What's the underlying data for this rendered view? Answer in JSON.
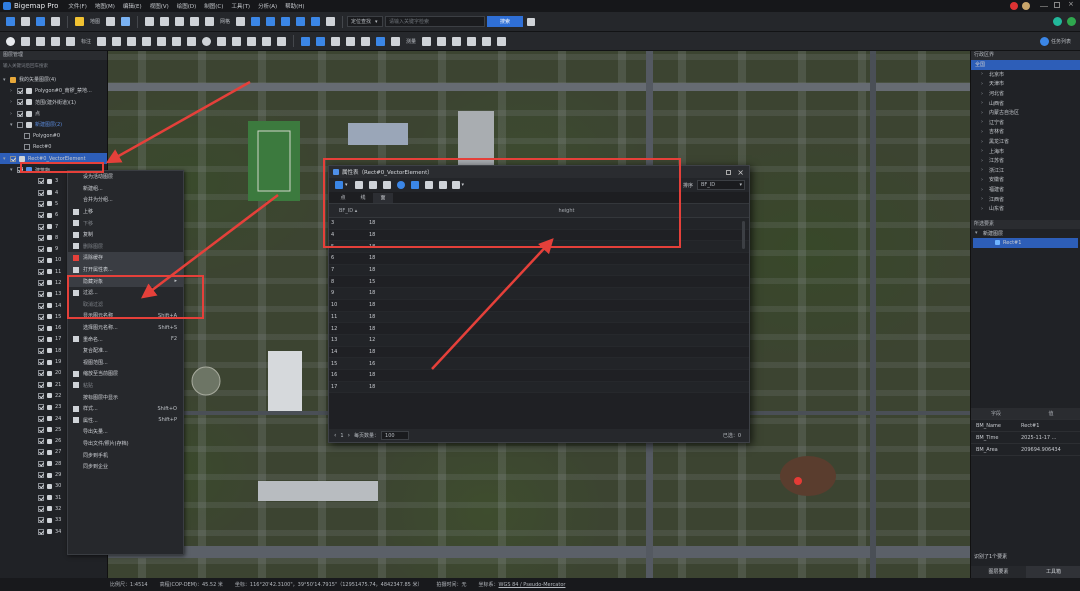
{
  "app": {
    "title": "Bigemap Pro"
  },
  "menu": [
    "文件(F)",
    "地图(M)",
    "编辑(E)",
    "视图(V)",
    "绘图(D)",
    "制图(C)",
    "工具(T)",
    "分析(A)",
    "帮助(H)"
  ],
  "toolbar1": {
    "labels": [
      "地图",
      "网格"
    ],
    "search_mode": "定位查找",
    "search_placeholder": "请输入关键字检索",
    "search_button": "搜索"
  },
  "toolbar2": {
    "labels": [
      "标注",
      "测量"
    ],
    "task_button": "任务列表"
  },
  "layers": {
    "header": "图层管理",
    "search_placeholder": "输入关键词后回车搜索",
    "items": [
      {
        "label": "我的矢量图层(4)"
      },
      {
        "label": "Polygon#0_南锣_禁地..."
      },
      {
        "label": "范围(建外街道)(1)"
      },
      {
        "label": "点"
      },
      {
        "label": "新建图层(2)"
      },
      {
        "label": "Polygon#0"
      },
      {
        "label": "Rect#0"
      },
      {
        "label": "Rect#0_VectorElement"
      },
      {
        "label": "建筑物"
      }
    ],
    "rows": [
      "3",
      "4",
      "5",
      "6",
      "7",
      "8",
      "9",
      "10",
      "11",
      "12",
      "13",
      "14",
      "15",
      "16",
      "17",
      "18",
      "19",
      "20",
      "21",
      "22",
      "23",
      "24",
      "25",
      "26",
      "27",
      "28",
      "29",
      "30",
      "31",
      "32",
      "33",
      "34"
    ]
  },
  "context_menu": [
    {
      "label": "设为活动图层",
      "shortcut": ""
    },
    {
      "label": "新建组...",
      "shortcut": ""
    },
    {
      "label": "合并为分组...",
      "shortcut": ""
    },
    {
      "label": "上移",
      "shortcut": ""
    },
    {
      "label": "下移",
      "shortcut": ""
    },
    {
      "label": "复制",
      "shortcut": ""
    },
    {
      "label": "删除图层",
      "shortcut": ""
    },
    {
      "label": "清除缓存",
      "shortcut": ""
    },
    {
      "label": "打开属性表...",
      "shortcut": ""
    },
    {
      "label": "隐藏对象",
      "shortcut": ""
    },
    {
      "label": "过滤...",
      "shortcut": ""
    },
    {
      "label": "取消过滤",
      "shortcut": ""
    },
    {
      "label": "显示图元名称",
      "shortcut": "Shift+A"
    },
    {
      "label": "选择图元名称...",
      "shortcut": "Shift+S"
    },
    {
      "label": "重命名...",
      "shortcut": "F2"
    },
    {
      "label": "复合配准...",
      "shortcut": ""
    },
    {
      "label": "视图范围...",
      "shortcut": ""
    },
    {
      "label": "缩放至当前图层",
      "shortcut": ""
    },
    {
      "label": "粘贴",
      "shortcut": ""
    },
    {
      "label": "按标图层中显示",
      "shortcut": ""
    },
    {
      "label": "样式...",
      "shortcut": "Shift+O"
    },
    {
      "label": "属性...",
      "shortcut": "Shift+P"
    },
    {
      "label": "导出矢量...",
      "shortcut": ""
    },
    {
      "label": "导出文件/照片(存档)",
      "shortcut": ""
    },
    {
      "label": "同步到手机",
      "shortcut": ""
    },
    {
      "label": "同步到企业",
      "shortcut": ""
    }
  ],
  "attr_window": {
    "title": "属性表（Rect#0_VectorElement）",
    "sort_label": "排序",
    "sort_field": "BF_ID",
    "tabs": [
      "点",
      "线",
      "面"
    ],
    "columns": [
      "BF_ID",
      "height"
    ],
    "rows": [
      [
        "3",
        "18"
      ],
      [
        "4",
        "18"
      ],
      [
        "5",
        "18"
      ],
      [
        "6",
        "18"
      ],
      [
        "7",
        "18"
      ],
      [
        "8",
        "15"
      ],
      [
        "9",
        "18"
      ],
      [
        "10",
        "18"
      ],
      [
        "11",
        "18"
      ],
      [
        "12",
        "18"
      ],
      [
        "13",
        "12"
      ],
      [
        "14",
        "18"
      ],
      [
        "15",
        "16"
      ],
      [
        "16",
        "18"
      ],
      [
        "17",
        "18"
      ]
    ],
    "footer": {
      "page": "1",
      "page_size_label": "每页数量：",
      "page_size": "100",
      "selected": "已选：0"
    }
  },
  "right_panel": {
    "header": "行政区界",
    "regions": [
      "全国",
      "北京市",
      "天津市",
      "河北省",
      "山西省",
      "内蒙古自治区",
      "辽宁省",
      "吉林省",
      "黑龙江省",
      "上海市",
      "江苏省",
      "浙江江",
      "安徽省",
      "福建省",
      "江西省",
      "山东省"
    ],
    "selected_header": "所选要素",
    "selected_group": "新建图层",
    "selected_item": "Rect#1",
    "props_header": [
      "字段",
      "值"
    ],
    "props": [
      [
        "BM_Name",
        "Rect#1"
      ],
      [
        "BM_Time",
        "2025-11-17 ..."
      ],
      [
        "BM_Area",
        "209694.906434"
      ]
    ],
    "status": "识别了1个要素",
    "tabs": [
      "图层要素",
      "工具箱"
    ]
  },
  "statusbar": {
    "scale_label": "比例尺：",
    "scale": "1:4514",
    "elev_label": "高程(COP-DEM)：",
    "elev": "45.52 米",
    "coord_label": "坐标：",
    "coord": "116°20'42.3100\"，39°50'14.7915\"（12951475.74，4842347.85 米）",
    "capture_label": "拍摄时间：",
    "capture": "无",
    "crs_label": "坐标系：",
    "crs": "WGS 84 / Pseudo-Mercator"
  },
  "colors": {
    "accent": "#2f7de1",
    "annotation": "#e5403a",
    "selection": "#2d5eb8"
  }
}
